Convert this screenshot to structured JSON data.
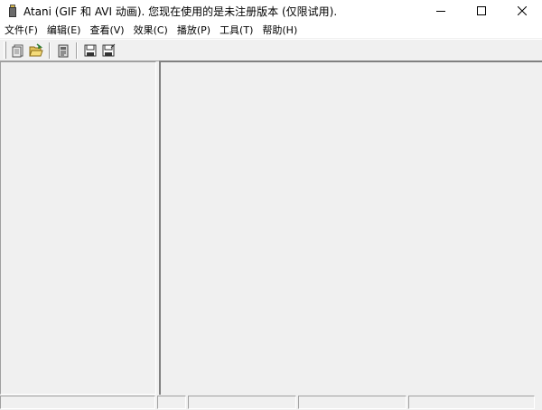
{
  "window": {
    "title": "Atani (GIF 和 AVI 动画). 您现在使用的是未注册版本 (仅限试用).",
    "app_icon": "film-canister-icon",
    "buttons": [
      "minimize-icon",
      "maximize-icon",
      "close-icon"
    ]
  },
  "menu": {
    "items": [
      {
        "label": "文件(F)"
      },
      {
        "label": "编辑(E)"
      },
      {
        "label": "查看(V)"
      },
      {
        "label": "效果(C)"
      },
      {
        "label": "播放(P)"
      },
      {
        "label": "工具(T)"
      },
      {
        "label": "帮助(H)"
      }
    ]
  },
  "toolbar": {
    "buttons": [
      "new-icon",
      "open-folder-icon",
      "properties-icon",
      "save-icon",
      "save-as-icon"
    ]
  },
  "statusbar": {
    "panels": [
      "",
      "",
      "",
      "",
      ""
    ]
  },
  "colors": {
    "face": "#f0f0f0",
    "shadow": "#a0a0a0",
    "dark_shadow": "#808080",
    "highlight": "#ffffff"
  }
}
